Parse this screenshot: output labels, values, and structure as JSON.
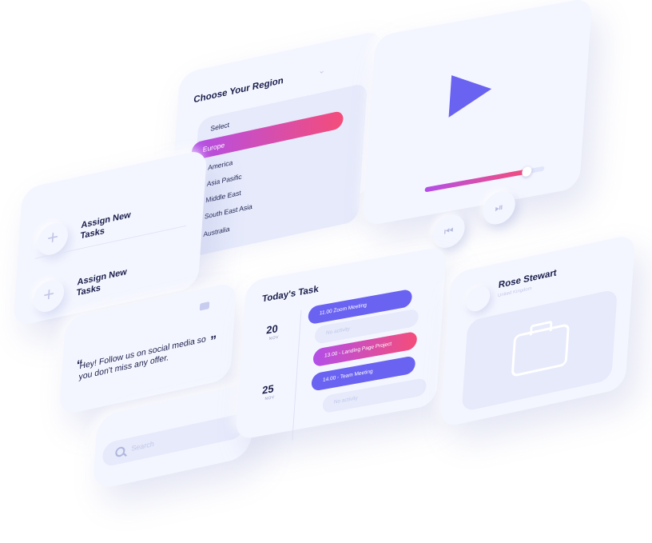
{
  "region": {
    "title": "Choose Your Region",
    "options": [
      "Select",
      "Europe",
      "America",
      "Asia Pasific",
      "Middle East",
      "South East Asia",
      "Australia"
    ],
    "selected": "Europe"
  },
  "player": {
    "progress": 0.85,
    "prev_icon": "skip-previous-icon",
    "play_pause_icon": "play-pause-icon"
  },
  "assign": {
    "items": [
      {
        "label": "Assign New Tasks"
      },
      {
        "label": "Assign New Tasks"
      }
    ]
  },
  "quote": {
    "text": "Hey! Follow us on social media so you don't miss any offer.",
    "open_mark": "“",
    "close_mark": "”"
  },
  "search": {
    "placeholder": "Search"
  },
  "today": {
    "title": "Today's Task",
    "dates": [
      {
        "day": "20",
        "month": "NOV"
      },
      {
        "day": "25",
        "month": "NOV"
      }
    ],
    "tasks": [
      {
        "label": "11.00 Zoom Meeting"
      },
      {
        "label": "No activity"
      },
      {
        "label": "13.00 - Landing Page Project"
      },
      {
        "label": "14.00 - Team Meeting"
      },
      {
        "label": "No activity"
      }
    ]
  },
  "profile": {
    "name": "Rose Stewart",
    "location": "United Kingdom"
  },
  "colors": {
    "accent": "#6a63f2",
    "gradient_start": "#b34ee8",
    "gradient_end": "#f44d7a",
    "text": "#1b1f4b",
    "surface": "#f4f6ff"
  }
}
